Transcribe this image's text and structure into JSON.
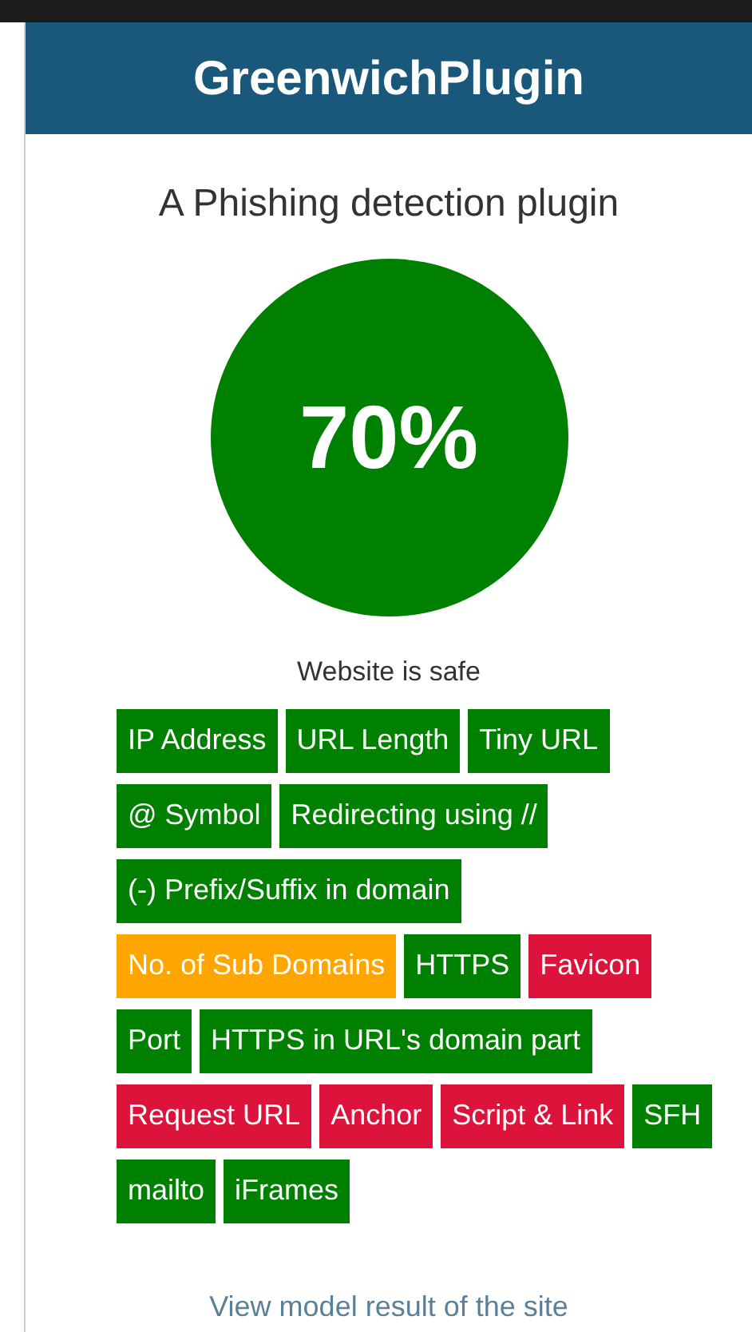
{
  "header": {
    "title": "GreenwichPlugin"
  },
  "subtitle": "A Phishing detection plugin",
  "score": {
    "value": "70%"
  },
  "verdict": "Website is safe",
  "features": [
    {
      "label": "IP Address",
      "color": "#008000"
    },
    {
      "label": "URL Length",
      "color": "#008000"
    },
    {
      "label": "Tiny URL",
      "color": "#008000"
    },
    {
      "label": "@ Symbol",
      "color": "#008000"
    },
    {
      "label": "Redirecting using //",
      "color": "#008000"
    },
    {
      "label": "(-) Prefix/Suffix in domain",
      "color": "#008000"
    },
    {
      "label": "No. of Sub Domains",
      "color": "#ffa500"
    },
    {
      "label": "HTTPS",
      "color": "#008000"
    },
    {
      "label": "Favicon",
      "color": "#dc143c"
    },
    {
      "label": "Port",
      "color": "#008000"
    },
    {
      "label": "HTTPS in URL's domain part",
      "color": "#008000"
    },
    {
      "label": "Request URL",
      "color": "#dc143c"
    },
    {
      "label": "Anchor",
      "color": "#dc143c"
    },
    {
      "label": "Script & Link",
      "color": "#dc143c"
    },
    {
      "label": "SFH",
      "color": "#008000"
    },
    {
      "label": "mailto",
      "color": "#008000"
    },
    {
      "label": "iFrames",
      "color": "#008000"
    }
  ],
  "link": "View model result of the site"
}
